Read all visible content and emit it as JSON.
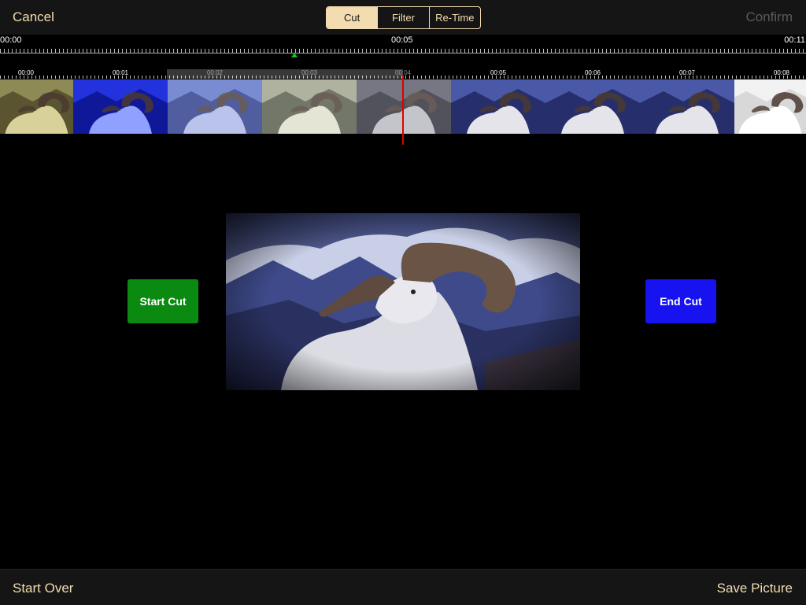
{
  "header": {
    "cancel_label": "Cancel",
    "confirm_label": "Confirm",
    "tabs": [
      "Cut",
      "Filter",
      "Re-Time"
    ],
    "active_tab": "Cut"
  },
  "overall_timeline": {
    "start": "00:00",
    "middle": "00:05",
    "end": "00:11"
  },
  "frame_strip": {
    "labels": [
      "00:00",
      "00:01",
      "00:02",
      "00:03",
      "00:04",
      "00:05",
      "00:06",
      "00:07",
      "00:08"
    ],
    "frames": [
      {
        "filter": "sepia",
        "sky": "#8e8a55",
        "mountain": "#5a5530",
        "ram": "#d8d29a"
      },
      {
        "filter": "blue",
        "sky": "#2233dd",
        "mountain": "#10189a",
        "ram": "#8fa0ff"
      },
      {
        "filter": "light-blue",
        "sky": "#5c73c8",
        "mountain": "#2a3b8a",
        "ram": "#aab6e8"
      },
      {
        "filter": "faded",
        "sky": "#9ea28a",
        "mountain": "#55594a",
        "ram": "#dfe0cc"
      },
      {
        "filter": "grayscale-dark",
        "sky": "#5a5a6a",
        "mountain": "#2c2c3a",
        "ram": "#b8b8c0"
      },
      {
        "filter": "vignette-blue",
        "sky": "#4a58a8",
        "mountain": "#262e6c",
        "ram": "#e4e4ea"
      },
      {
        "filter": "vignette-blue",
        "sky": "#4a58a8",
        "mountain": "#262e6c",
        "ram": "#e4e4ea"
      },
      {
        "filter": "vignette-blue",
        "sky": "#4a58a8",
        "mountain": "#262e6c",
        "ram": "#e4e4ea"
      },
      {
        "filter": "sketch",
        "sky": "#f2f2f2",
        "mountain": "#d8d8d8",
        "ram": "#ffffff"
      }
    ]
  },
  "buttons": {
    "start_cut": "Start Cut",
    "end_cut": "End Cut"
  },
  "preview": {
    "icon": "ram-photo"
  },
  "footer": {
    "start_over": "Start Over",
    "save_picture": "Save Picture"
  },
  "colors": {
    "accent": "#f3dcb0",
    "start_cut": "#0b8a12",
    "end_cut": "#1612f0",
    "playhead": "#e00000",
    "position_marker": "#18c018"
  }
}
